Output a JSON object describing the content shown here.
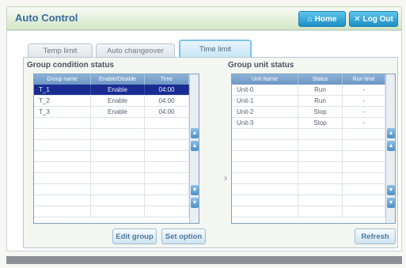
{
  "window": {
    "title": "Auto Control",
    "home_label": "Home",
    "logout_label": "Log Out"
  },
  "tabs": [
    {
      "label": "Temp limit"
    },
    {
      "label": "Auto changeover"
    },
    {
      "label": "Time limit"
    }
  ],
  "group_condition": {
    "section_label": "Group condition status",
    "columns": [
      "Group name",
      "Enable/Disable",
      "Time"
    ],
    "rows": [
      {
        "name": "T_1",
        "status": "Enable",
        "time": "04:00"
      },
      {
        "name": "T_2",
        "status": "Enable",
        "time": "04:00"
      },
      {
        "name": "T_3",
        "status": "Enable",
        "time": "04:00"
      }
    ],
    "selected_row": 0
  },
  "group_unit": {
    "section_label": "Group unit status",
    "columns": [
      "Unit Name",
      "Status",
      "Run time"
    ],
    "rows": [
      {
        "name": "Unit-0",
        "status": "Run",
        "runtime": "-"
      },
      {
        "name": "Unit-1",
        "status": "Run",
        "runtime": "-"
      },
      {
        "name": "Unit-2",
        "status": "Stop",
        "runtime": "-"
      },
      {
        "name": "Unit-3",
        "status": "Stop",
        "runtime": "-"
      }
    ]
  },
  "buttons": {
    "edit_group": "Edit group",
    "set_option": "Set option",
    "refresh": "Refresh"
  },
  "icons": {
    "home": "home-icon",
    "logout": "close-icon",
    "arrow": "chevron-right-icon"
  }
}
